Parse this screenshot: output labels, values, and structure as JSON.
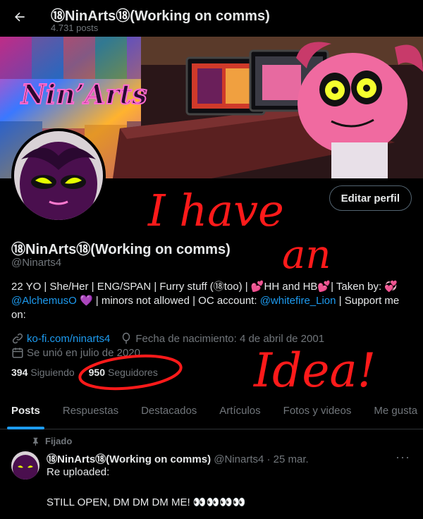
{
  "header": {
    "title": "⑱NinArts⑱(Working on comms)",
    "posts_count": "4.731 posts"
  },
  "banner": {
    "logo_text": "Nin’Arts"
  },
  "profile": {
    "edit_label": "Editar perfil",
    "display_name": "⑱NinArts⑱(Working on comms)",
    "handle": "@Ninarts4",
    "bio": {
      "p1": "22 YO | She/Her | ENG/SPAN | Furry stuff (⑱too) | ",
      "heart1": "💕",
      "p2": "HH and HB",
      "heart2": "💕",
      "p3": "| Taken by: ",
      "heart3": "💞",
      "mention1": "@AlchemusO",
      "purple": "💜",
      "p4": " | minors not allowed | OC account: ",
      "mention2": "@whitefire_Lion",
      "p5": " | Support me on:"
    },
    "link": "ko-fi.com/ninarts4",
    "birthday": "Fecha de nacimiento: 4 de abril de 2001",
    "joined": "Se unió en julio de 2020",
    "following_count": "394",
    "following_label": "Siguiendo",
    "followers_count": "950",
    "followers_label": "Seguidores"
  },
  "tabs": [
    "Posts",
    "Respuestas",
    "Destacados",
    "Artículos",
    "Fotos y videos",
    "Me gusta"
  ],
  "post": {
    "pinned_label": "Fijado",
    "name": "⑱NinArts⑱(Working on comms)",
    "handle": "@Ninarts4",
    "date": "· 25 mar.",
    "more": "···",
    "line1": "Re uploaded:",
    "line2": "STILL OPEN, DM DM DM ME! 👀👀👀👀"
  },
  "annotation": {
    "line1": "I have",
    "line2": "an",
    "line3": "Idea!",
    "color": "#ff1a1a"
  },
  "colors": {
    "accent": "#1d9bf0",
    "muted": "#71767b",
    "text": "#e7e9ea",
    "border": "#2f3336"
  }
}
